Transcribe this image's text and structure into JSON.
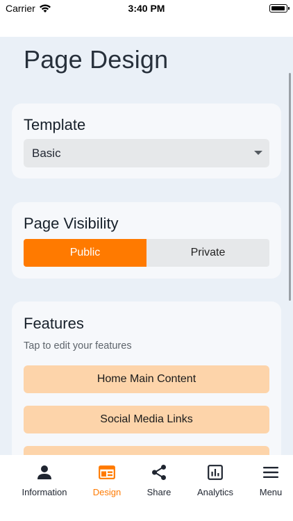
{
  "status_bar": {
    "carrier": "Carrier",
    "time": "3:40 PM"
  },
  "page": {
    "title": "Page Design"
  },
  "template_section": {
    "title": "Template",
    "selected": "Basic"
  },
  "visibility_section": {
    "title": "Page Visibility",
    "options": [
      "Public",
      "Private"
    ],
    "selected": "Public"
  },
  "features_section": {
    "title": "Features",
    "subtitle": "Tap to edit your features",
    "items": [
      "Home Main Content",
      "Social Media Links",
      ""
    ]
  },
  "tab_bar": {
    "active": "Design",
    "tabs": [
      {
        "label": "Information",
        "icon": "person-icon"
      },
      {
        "label": "Design",
        "icon": "design-layout-icon"
      },
      {
        "label": "Share",
        "icon": "share-icon"
      },
      {
        "label": "Analytics",
        "icon": "analytics-icon"
      },
      {
        "label": "Menu",
        "icon": "hamburger-menu-icon"
      }
    ]
  },
  "colors": {
    "accent": "#ff7a00",
    "feature_button": "#fdd4aa",
    "background": "#eaf0f7",
    "card": "#f6f8fb"
  }
}
